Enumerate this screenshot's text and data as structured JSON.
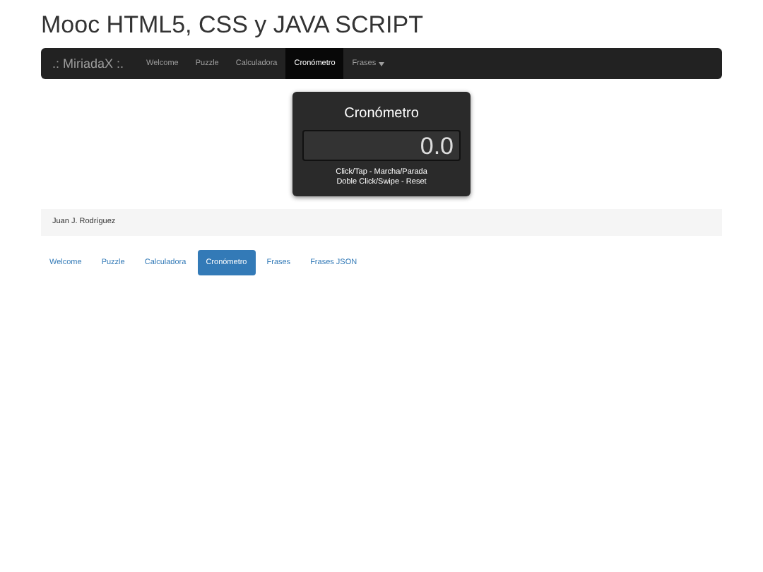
{
  "title": "Mooc HTML5, CSS y JAVA SCRIPT",
  "navbar": {
    "brand": ".: MiriadaX :.",
    "items": [
      {
        "label": "Welcome",
        "selected": false,
        "kind": "link"
      },
      {
        "label": "Puzzle",
        "selected": false,
        "kind": "link"
      },
      {
        "label": "Calculadora",
        "selected": false,
        "kind": "link"
      },
      {
        "label": "Cronómetro",
        "selected": true,
        "kind": "link"
      },
      {
        "label": "Frases",
        "selected": false,
        "kind": "dropdown"
      }
    ]
  },
  "stopwatch": {
    "title": "Cronómetro",
    "display": "0.0",
    "hints": [
      "Click/Tap - Marcha/Parada",
      "Doble Click/Swipe - Reset"
    ]
  },
  "footer": {
    "author": "Juan J. Rodríguez"
  },
  "pills": [
    {
      "label": "Welcome",
      "selected": false
    },
    {
      "label": "Puzzle",
      "selected": false
    },
    {
      "label": "Calculadora",
      "selected": false
    },
    {
      "label": "Cronómetro",
      "selected": true
    },
    {
      "label": "Frases",
      "selected": false
    },
    {
      "label": "Frases JSON",
      "selected": false
    }
  ]
}
